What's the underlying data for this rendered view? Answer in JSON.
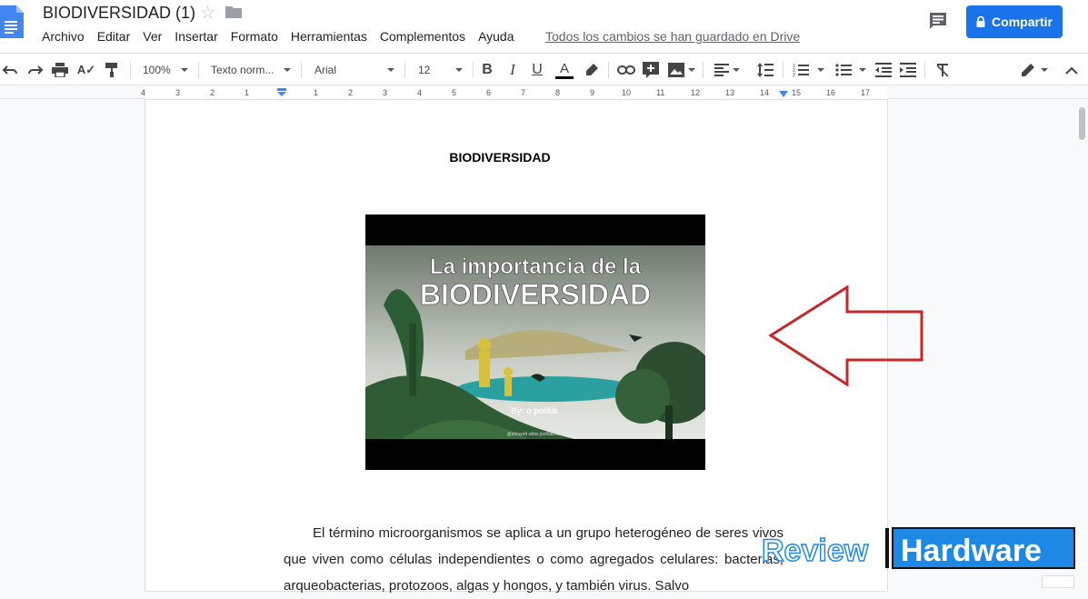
{
  "header": {
    "title": "BIODIVERSIDAD (1)",
    "menu": [
      "Archivo",
      "Editar",
      "Ver",
      "Insertar",
      "Formato",
      "Herramientas",
      "Complementos",
      "Ayuda"
    ],
    "saved_status": "Todos los cambios se han guardado en Drive",
    "share_label": "Compartir"
  },
  "toolbar": {
    "zoom": "100%",
    "style": "Texto norm...",
    "font": "Arial",
    "size": "12"
  },
  "ruler": {
    "marks": [
      "4",
      "3",
      "2",
      "1",
      "1",
      "2",
      "3",
      "4",
      "5",
      "6",
      "7",
      "8",
      "9",
      "10",
      "11",
      "12",
      "13",
      "14",
      "15",
      "16",
      "17"
    ]
  },
  "document": {
    "heading": "BIODIVERSIDAD",
    "image": {
      "line1": "La importancia de la",
      "line2": "BIODIVERSIDAD",
      "byline": "By: o politik",
      "tiny_credit": "@elnuyuh.wikis    joolhab.net"
    },
    "body": "El término microorganismos se aplica a un grupo heterogéneo de seres vivos que viven como células independientes o como agregados celulares: bacterias, arqueobacterias, protozoos, algas y hongos, y también virus. Salvo"
  },
  "watermark": {
    "left": "Review",
    "right": "Hardware"
  },
  "colors": {
    "accent": "#1a73e8",
    "arrow": "#c62828",
    "watermark_blue": "#1e88e5"
  }
}
